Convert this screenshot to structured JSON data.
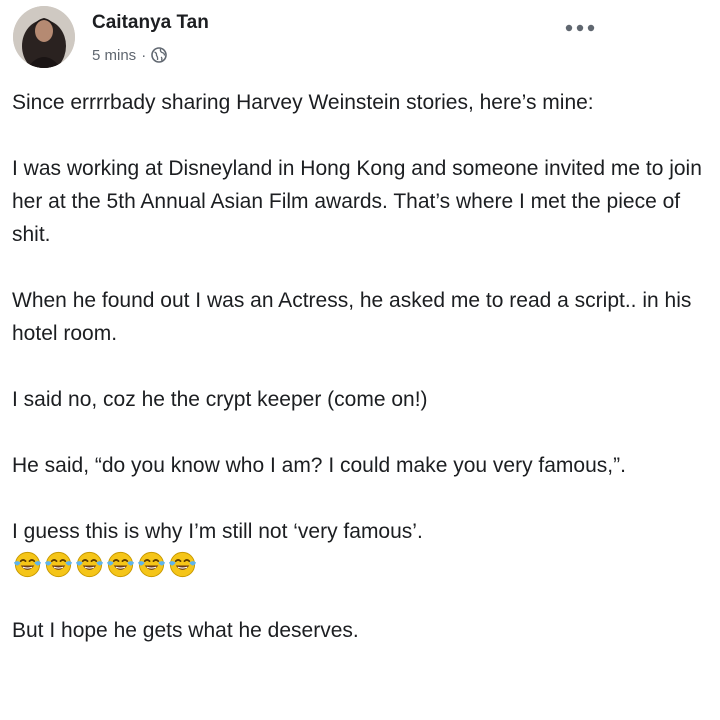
{
  "post": {
    "author_name": "Caitanya Tan",
    "timestamp": "5 mins",
    "separator": "·",
    "privacy_icon": "globe-icon",
    "more_icon": "ellipsis-icon",
    "paragraphs": [
      "Since errrrbady sharing Harvey Weinstein stories, here’s mine:",
      "I was working at Disneyland in Hong Kong and someone invited me to join her at the 5th Annual Asian Film awards. That’s where I met the piece of shit.",
      "When he found out I was an Actress, he asked me to read a script.. in his hotel room.",
      "I said no, coz he the crypt keeper (come on!)",
      "He said, “do you know who I am? I could make you very famous,”.",
      "I guess this is why I’m still not ‘very famous’."
    ],
    "emoji": {
      "name": "face-with-tears-of-joy",
      "count": 6
    },
    "closing": "But I hope he gets what he deserves."
  }
}
